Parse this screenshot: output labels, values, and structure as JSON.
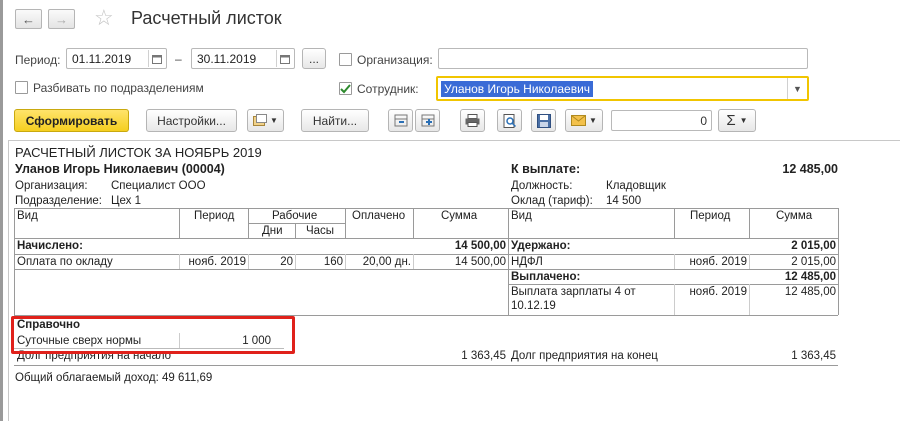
{
  "header": {
    "title": "Расчетный листок"
  },
  "filters": {
    "period_label": "Период:",
    "date_from": "01.11.2019",
    "date_dash": "–",
    "date_to": "30.11.2019",
    "ellipsis": "...",
    "org_label": "Организация:",
    "org_value": "",
    "split_label": "Разбивать по подразделениям",
    "employee_label": "Сотрудник:",
    "employee_value": "Уланов Игорь Николаевич",
    "employee_checked": true,
    "split_checked": false
  },
  "toolbar": {
    "generate": "Сформировать",
    "settings": "Настройки...",
    "find": "Найти...",
    "sum_value": "0",
    "sigma": "Σ"
  },
  "report": {
    "title": "РАСЧЕТНЫЙ ЛИСТОК ЗА НОЯБРЬ 2019",
    "employee": "Уланов  Игорь Николаевич (00004)",
    "to_pay_label": "К выплате:",
    "to_pay_value": "12 485,00",
    "org_label": "Организация:",
    "org_value": "Специалист ООО",
    "dept_label": "Подразделение:",
    "dept_value": "Цех 1",
    "position_label": "Должность:",
    "position_value": "Кладовщик",
    "salary_label": "Оклад (тариф):",
    "salary_value": "14 500",
    "left_headers": {
      "vid": "Вид",
      "period": "Период",
      "work": "Рабочие",
      "days": "Дни",
      "hours": "Часы",
      "paid": "Оплачено",
      "sum": "Сумма"
    },
    "right_headers": {
      "vid": "Вид",
      "period": "Период",
      "sum": "Сумма"
    },
    "accrued_label": "Начислено:",
    "accrued_total": "14 500,00",
    "accrual_row": {
      "vid": "Оплата по окладу",
      "period": "нояб. 2019",
      "days": "20",
      "hours": "160",
      "paid": "20,00 дн.",
      "sum": "14 500,00"
    },
    "withheld_label": "Удержано:",
    "withheld_total": "2 015,00",
    "withheld_row": {
      "vid": "НДФЛ",
      "period": "нояб. 2019",
      "sum": "2 015,00"
    },
    "paid_label": "Выплачено:",
    "paid_total": "12 485,00",
    "paid_row": {
      "vid_line1": "Выплата зарплаты 4 от",
      "vid_line2": "10.12.19",
      "period": "нояб. 2019",
      "sum": "12 485,00"
    },
    "reference_label": "Справочно",
    "reference_row": {
      "vid": "Суточные сверх нормы",
      "sum": "1 000"
    },
    "debt_start_label": "Долг предприятия на начало",
    "debt_start_value": "1 363,45",
    "debt_end_label": "Долг предприятия на конец",
    "debt_end_value": "1 363,45",
    "taxable_income": "Общий облагаемый доход: 49 611,69"
  },
  "colors": {
    "accent_yellow": "#f5cf1f",
    "highlight_red": "#e0211b",
    "selection": "#3a6bd6"
  }
}
